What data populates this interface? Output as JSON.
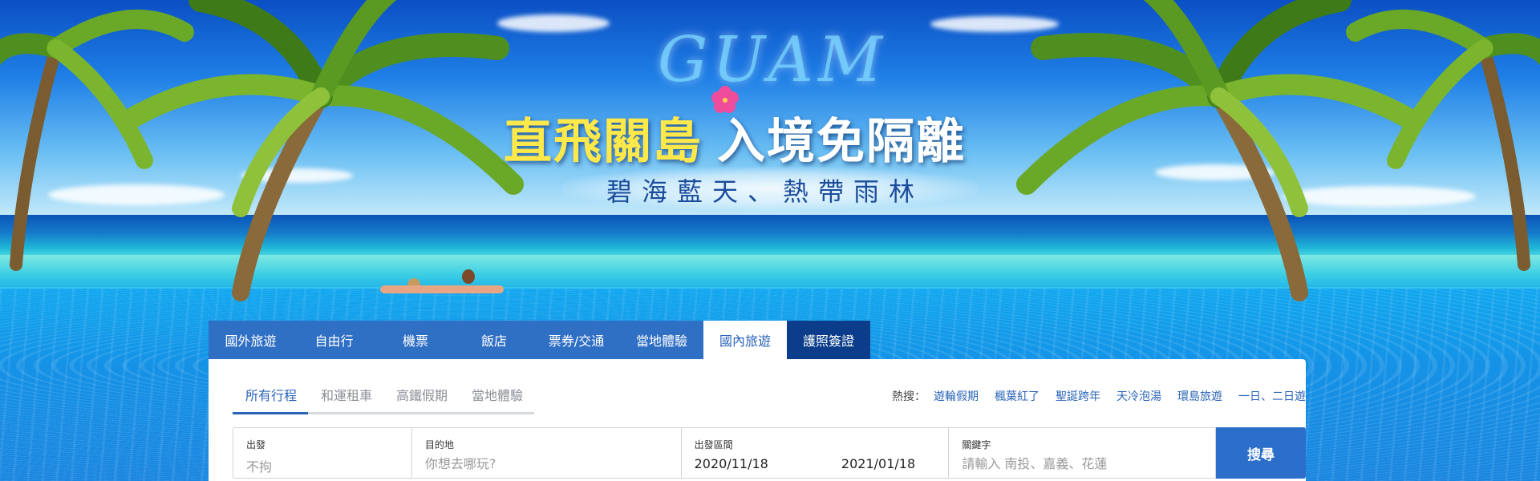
{
  "banner": {
    "watermark": "GUAM",
    "headline_part1": "直飛關島",
    "headline_part2": "入境免隔離",
    "subline": "碧海藍天、熱帶雨林"
  },
  "tabs": [
    {
      "label": "國外旅遊",
      "state": "normal"
    },
    {
      "label": "自由行",
      "state": "normal"
    },
    {
      "label": "機票",
      "state": "normal"
    },
    {
      "label": "飯店",
      "state": "normal"
    },
    {
      "label": "票券/交通",
      "state": "normal"
    },
    {
      "label": "當地體驗",
      "state": "normal"
    },
    {
      "label": "國內旅遊",
      "state": "active"
    },
    {
      "label": "護照簽證",
      "state": "dark"
    }
  ],
  "subtabs": [
    {
      "label": "所有行程",
      "active": true
    },
    {
      "label": "和運租車",
      "active": false
    },
    {
      "label": "高鐵假期",
      "active": false
    },
    {
      "label": "當地體驗",
      "active": false
    }
  ],
  "hot_search": {
    "label": "熱搜：",
    "links": [
      "遊輪假期",
      "楓葉紅了",
      "聖誕跨年",
      "天冷泡湯",
      "環島旅遊",
      "一日、二日遊"
    ]
  },
  "form": {
    "departure": {
      "label": "出發",
      "value": "不拘"
    },
    "destination": {
      "label": "目的地",
      "placeholder": "你想去哪玩?"
    },
    "period": {
      "label": "出發區間",
      "start": "2020/11/18",
      "end": "2021/01/18"
    },
    "keyword": {
      "label": "關鍵字",
      "placeholder": "請輸入 南投、嘉義、花蓮"
    },
    "search_label": "搜尋"
  },
  "colors": {
    "tab_bg": "#2f6fc4",
    "tab_dark": "#0b3d8a",
    "accent": "#2a64b8",
    "button": "#2b6fca",
    "headline_yellow": "#ffe94a"
  }
}
